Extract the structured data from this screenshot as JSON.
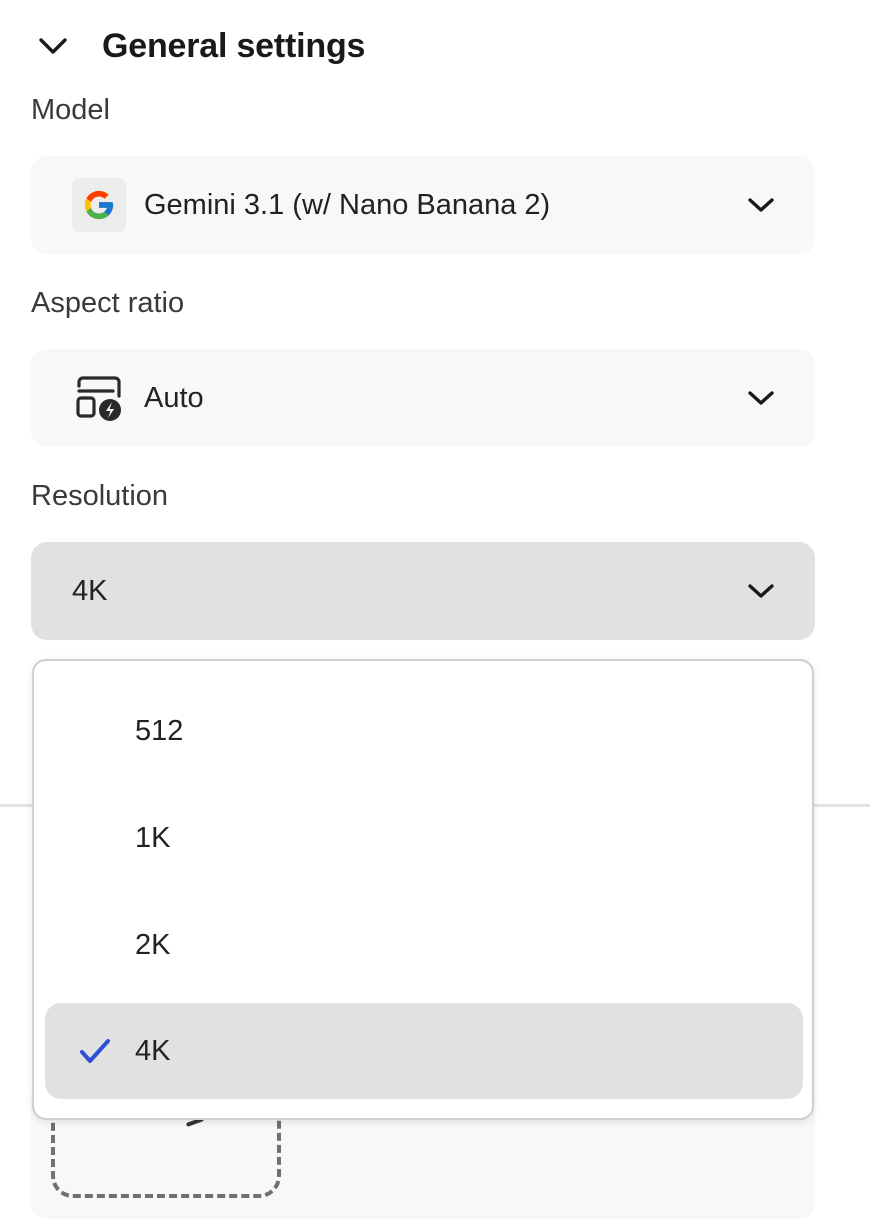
{
  "section": {
    "title": "General settings",
    "toggle_icon": "chevron-down-icon"
  },
  "model": {
    "label": "Model",
    "value": "Gemini 3.1 (w/ Nano Banana 2)",
    "icon": "google-g-icon"
  },
  "aspect_ratio": {
    "label": "Aspect ratio",
    "value": "Auto",
    "icon": "auto-aspect-ratio-icon"
  },
  "resolution": {
    "label": "Resolution",
    "value": "4K",
    "options": [
      {
        "label": "512",
        "selected": false
      },
      {
        "label": "1K",
        "selected": false
      },
      {
        "label": "2K",
        "selected": false
      },
      {
        "label": "4K",
        "selected": true
      }
    ]
  },
  "colors": {
    "checkmark": "#2c4fd8",
    "selected_bg": "#e1e1e1",
    "picker_bg": "#f8f8f8"
  }
}
